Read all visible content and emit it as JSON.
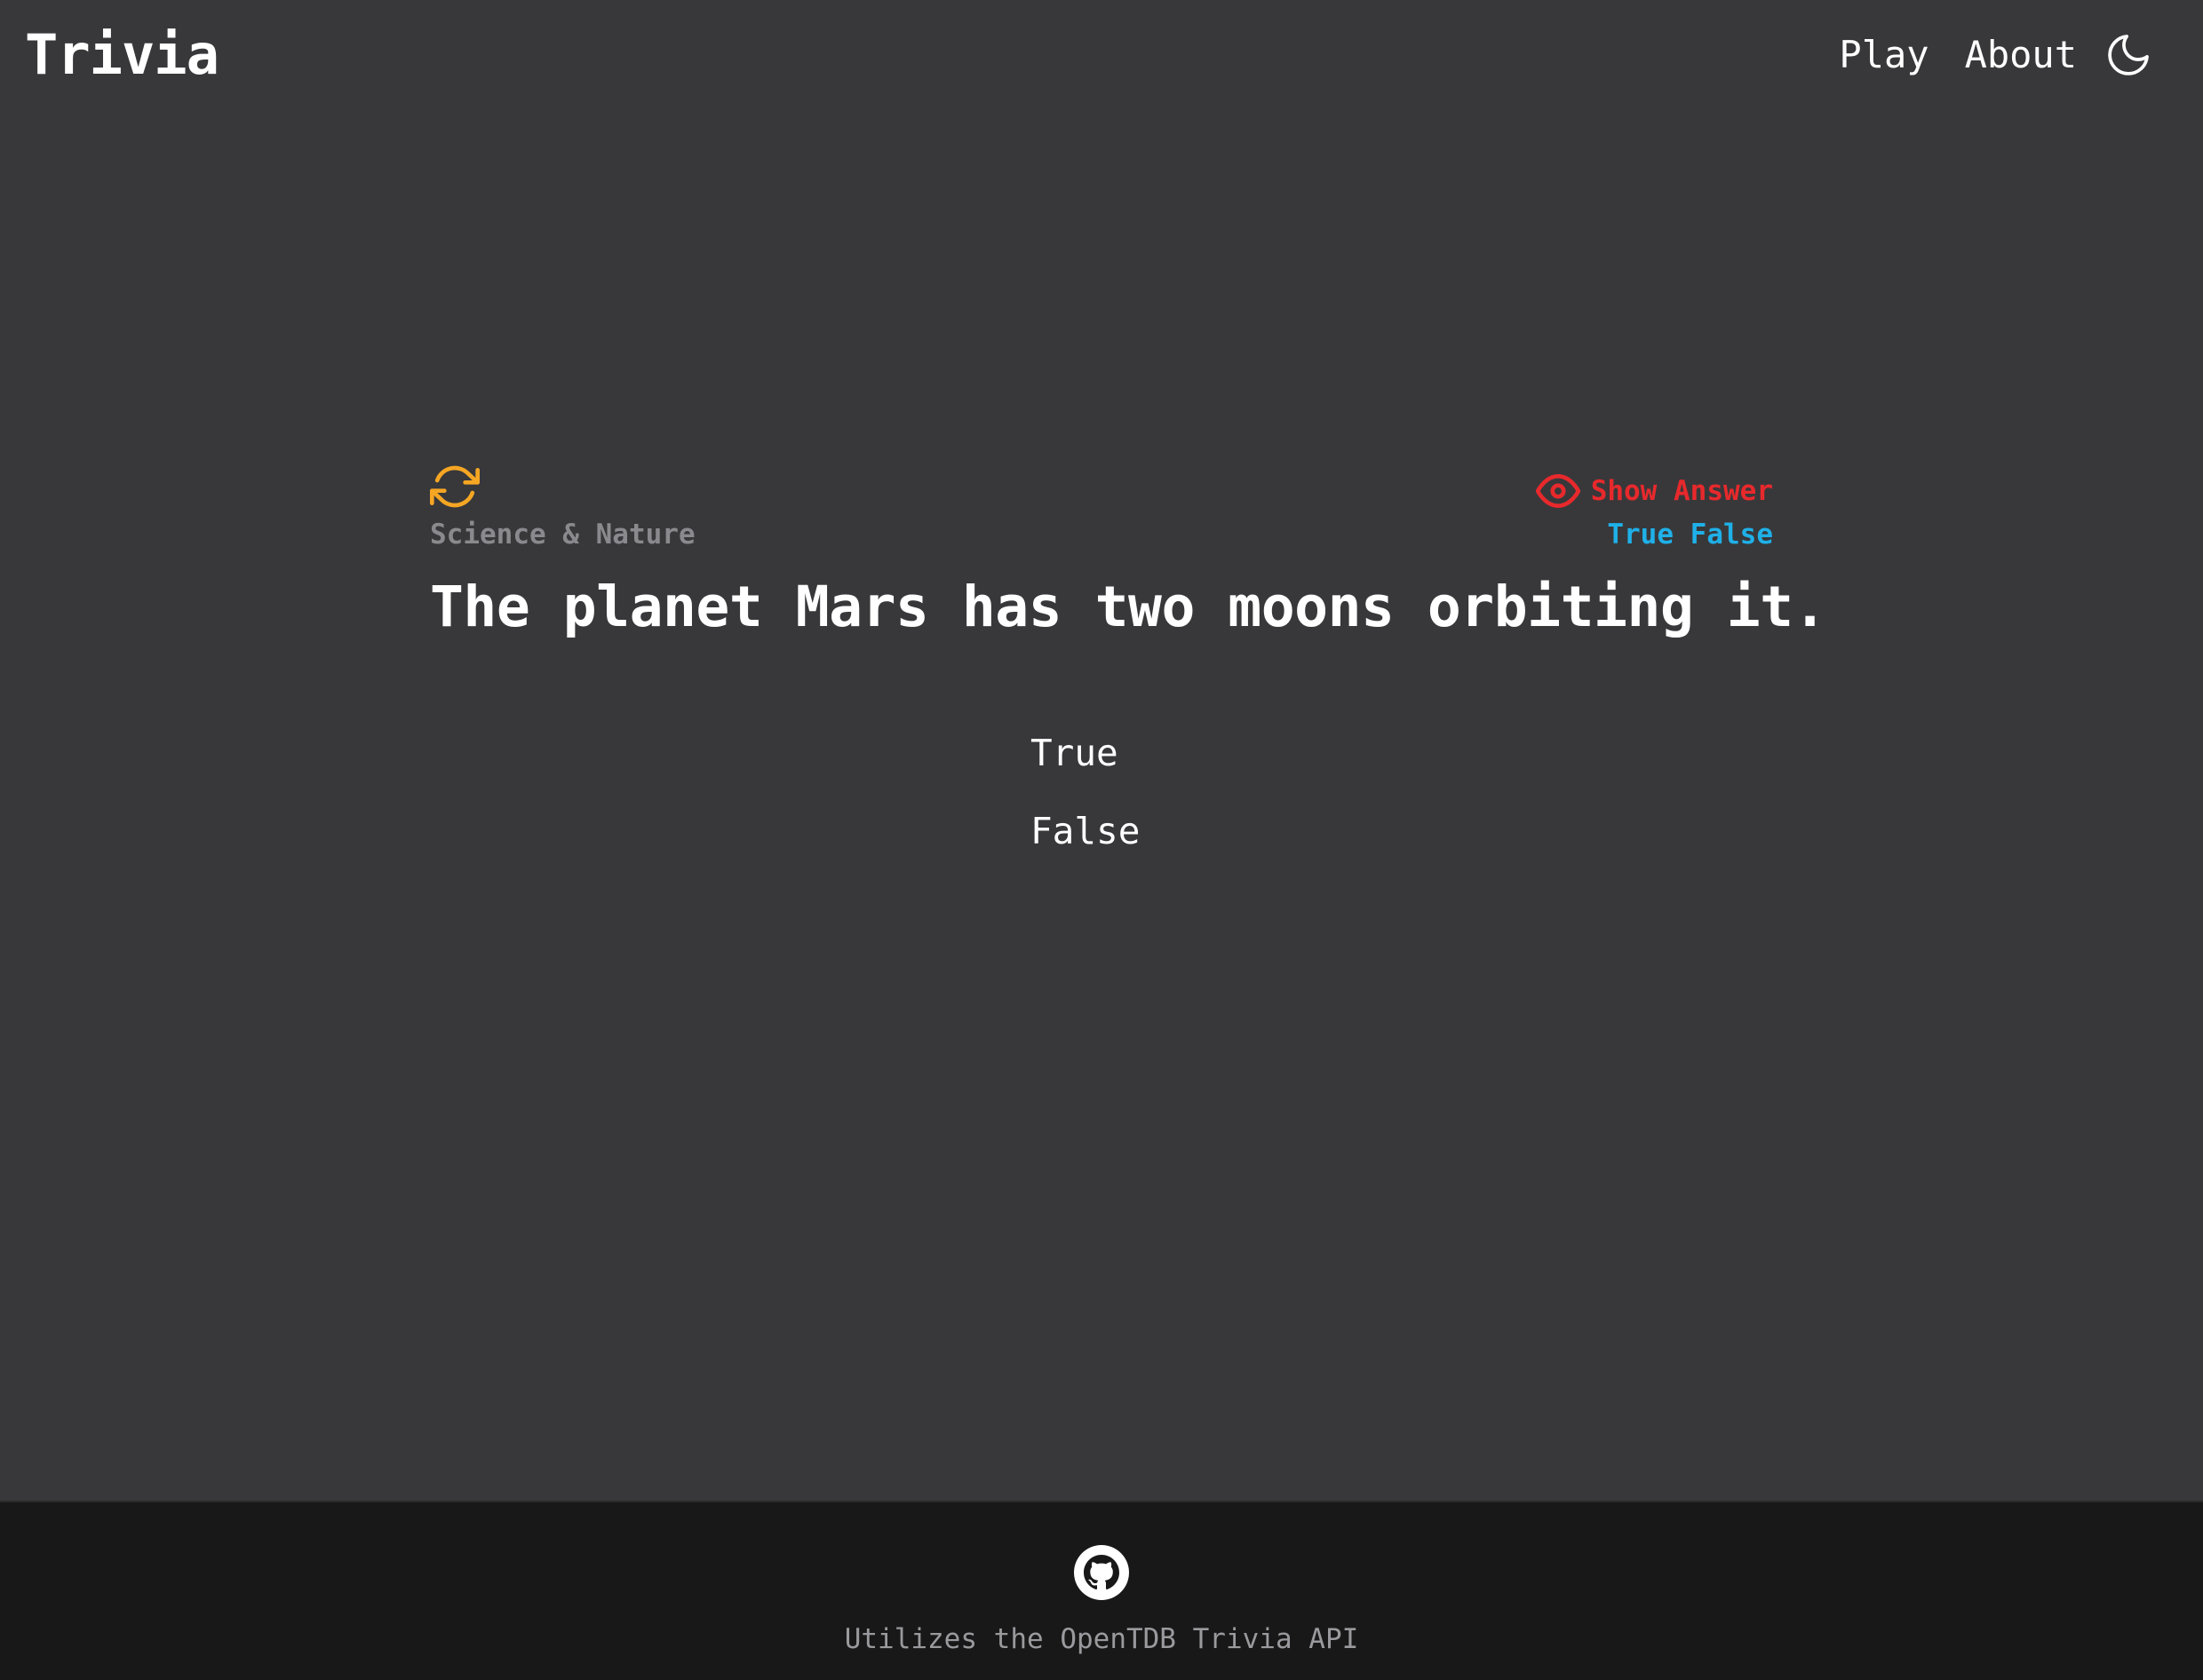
{
  "header": {
    "brand": "Trivia",
    "nav": {
      "play_label": "Play",
      "about_label": "About"
    },
    "theme_icon": "moon-icon"
  },
  "question": {
    "refresh_icon": "refresh-icon",
    "category": "Science & Nature",
    "show_answer_label": "Show Answer",
    "show_answer_icon": "eye-icon",
    "answer_reveal": "True False",
    "text": "The planet Mars has two moons orbiting it.",
    "choices": [
      "True",
      "False"
    ]
  },
  "footer": {
    "github_icon": "github-icon",
    "credit": "Utilizes the OpenTDB Trivia API"
  },
  "colors": {
    "background": "#38383b",
    "footer_background": "#181818",
    "refresh_accent": "#f5a623",
    "show_answer": "#e8292c",
    "answer_reveal": "#1fb0e8",
    "category": "#8a8a8e"
  }
}
